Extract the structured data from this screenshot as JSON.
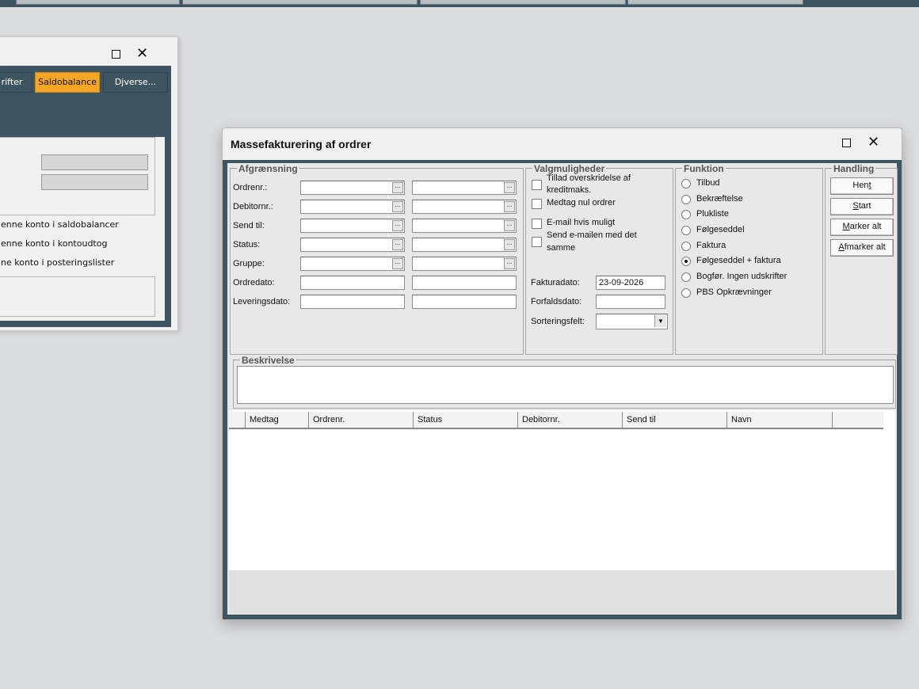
{
  "bg_window": {
    "tabs": [
      {
        "label": "rifter"
      },
      {
        "label": "Saldobalance"
      },
      {
        "label": "Djverse..."
      }
    ],
    "lines": [
      "enne konto i saldobalancer",
      "enne konto i kontoudtog",
      "ne konto i posteringslister"
    ]
  },
  "window": {
    "title": "Massefakturering af ordrer"
  },
  "afgraensning": {
    "legend": "Afgrænsning",
    "rows": [
      {
        "label": "Ordrenr.:"
      },
      {
        "label": "Debitornr.:"
      },
      {
        "label": "Send til:"
      },
      {
        "label": "Status:"
      },
      {
        "label": "Gruppe:"
      },
      {
        "label": "Ordredato:"
      },
      {
        "label": "Leveringsdato:"
      }
    ]
  },
  "valgmuligheder": {
    "legend": "Valgmuligheder",
    "options": [
      {
        "label_line1": "Tillad overskridelse af",
        "label_line2": "kreditmaks."
      },
      {
        "label_line1": "Medtag nul ordrer",
        "label_line2": ""
      },
      {
        "label_line1": "E-mail hvis muligt",
        "label_line2": ""
      },
      {
        "label_line1": "Send e-mailen med det",
        "label_line2": "samme"
      }
    ],
    "fakturadato_label": "Fakturadato:",
    "fakturadato_value": "23-09-2026",
    "forfaldsdato_label": "Forfaldsdato:",
    "sorteringsfelt_label": "Sorteringsfelt:"
  },
  "funktion": {
    "legend": "Funktion",
    "options": [
      "Tilbud",
      "Bekræftelse",
      "Plukliste",
      "Følgeseddel",
      "Faktura",
      "Følgeseddel + faktura",
      "Bogfør. Ingen udskrifter",
      "PBS Opkrævninger"
    ],
    "selected": "Følgeseddel + faktura"
  },
  "handling": {
    "legend": "Handling",
    "buttons": [
      {
        "pre": "Hen",
        "u": "t",
        "post": ""
      },
      {
        "pre": "",
        "u": "S",
        "post": "tart"
      },
      {
        "pre": "",
        "u": "M",
        "post": "arker alt"
      },
      {
        "pre": "",
        "u": "A",
        "post": "fmarker alt"
      }
    ]
  },
  "beskrivelse": {
    "legend": "Beskrivelse"
  },
  "grid": {
    "columns": [
      "",
      "Medtag",
      "Ordrenr.",
      "Status",
      "Debitornr.",
      "Send til",
      "Navn",
      ""
    ]
  },
  "colors": {
    "accent": "#3e5461",
    "active_tab": "#f5a623"
  }
}
